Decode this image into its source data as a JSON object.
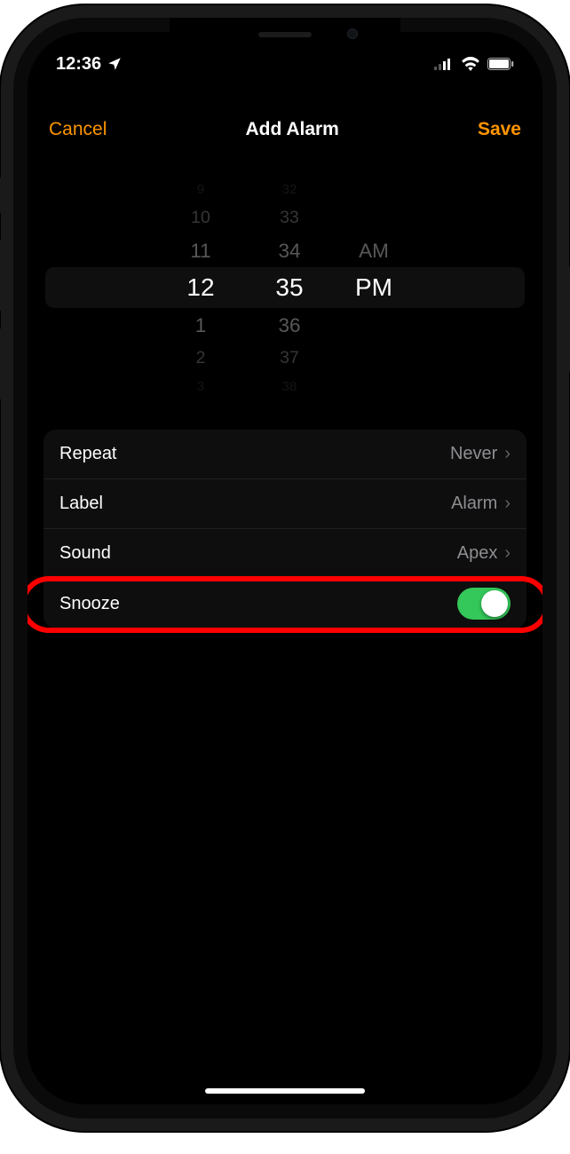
{
  "status": {
    "time": "12:36",
    "location_icon": "location-arrow-icon",
    "cellular_icon": "cellular-icon",
    "wifi_icon": "wifi-icon",
    "battery_icon": "battery-icon"
  },
  "nav": {
    "cancel": "Cancel",
    "title": "Add Alarm",
    "save": "Save"
  },
  "picker": {
    "hours": [
      "9",
      "10",
      "11",
      "12",
      "1",
      "2",
      "3"
    ],
    "minutes": [
      "32",
      "33",
      "34",
      "35",
      "36",
      "37",
      "38"
    ],
    "ampm": [
      "AM",
      "PM"
    ],
    "selected_hour": "12",
    "selected_minute": "35",
    "selected_ampm": "PM"
  },
  "settings": {
    "repeat_label": "Repeat",
    "repeat_value": "Never",
    "label_label": "Label",
    "label_value": "Alarm",
    "sound_label": "Sound",
    "sound_value": "Apex",
    "snooze_label": "Snooze",
    "snooze_on": true
  }
}
